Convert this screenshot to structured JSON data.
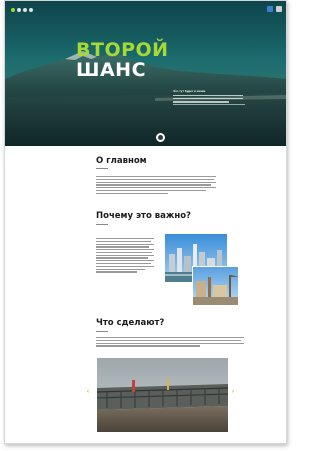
{
  "hero": {
    "title_line1": "ВТОРОЙ",
    "title_line2": "ШАНС",
    "caption_title": "Что тут будет и зачем"
  },
  "sections": [
    {
      "heading": "О главном"
    },
    {
      "heading": "Почему это важно?"
    },
    {
      "heading": "Что сделают?"
    }
  ],
  "colors": {
    "accent_green": "#a6d936",
    "hero_teal": "#1b6a6c",
    "arrow_gold": "#c8a24a"
  },
  "icons": {
    "nav_dots": "dots-menu-icon",
    "top_right_a": "share-icon",
    "top_right_b": "close-icon",
    "scroll": "scroll-down-icon",
    "slider_prev": "chevron-left-icon",
    "slider_next": "chevron-right-icon"
  }
}
